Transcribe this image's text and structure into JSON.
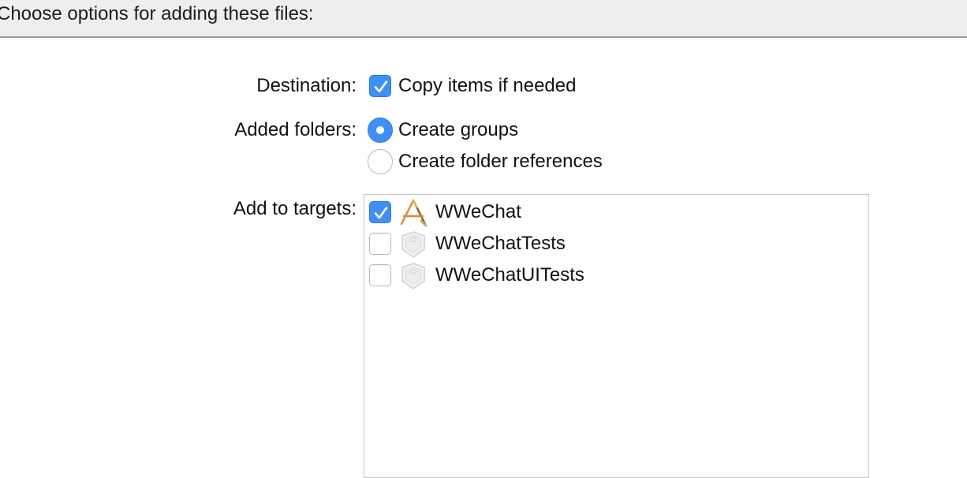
{
  "header": {
    "title": "Choose options for adding these files:"
  },
  "destination": {
    "label": "Destination:",
    "option_label": "Copy items if needed",
    "checked": true
  },
  "added_folders": {
    "label": "Added folders:",
    "options": [
      {
        "label": "Create groups",
        "selected": true
      },
      {
        "label": "Create folder references",
        "selected": false
      }
    ]
  },
  "targets": {
    "label": "Add to targets:",
    "items": [
      {
        "name": "WWeChat",
        "checked": true,
        "icon": "app-target-icon"
      },
      {
        "name": "WWeChatTests",
        "checked": false,
        "icon": "test-bundle-icon"
      },
      {
        "name": "WWeChatUITests",
        "checked": false,
        "icon": "test-bundle-icon"
      }
    ]
  },
  "colors": {
    "accent": "#3f8ff6",
    "header_bg": "#eeeeee",
    "divider": "#9d9d9d"
  }
}
